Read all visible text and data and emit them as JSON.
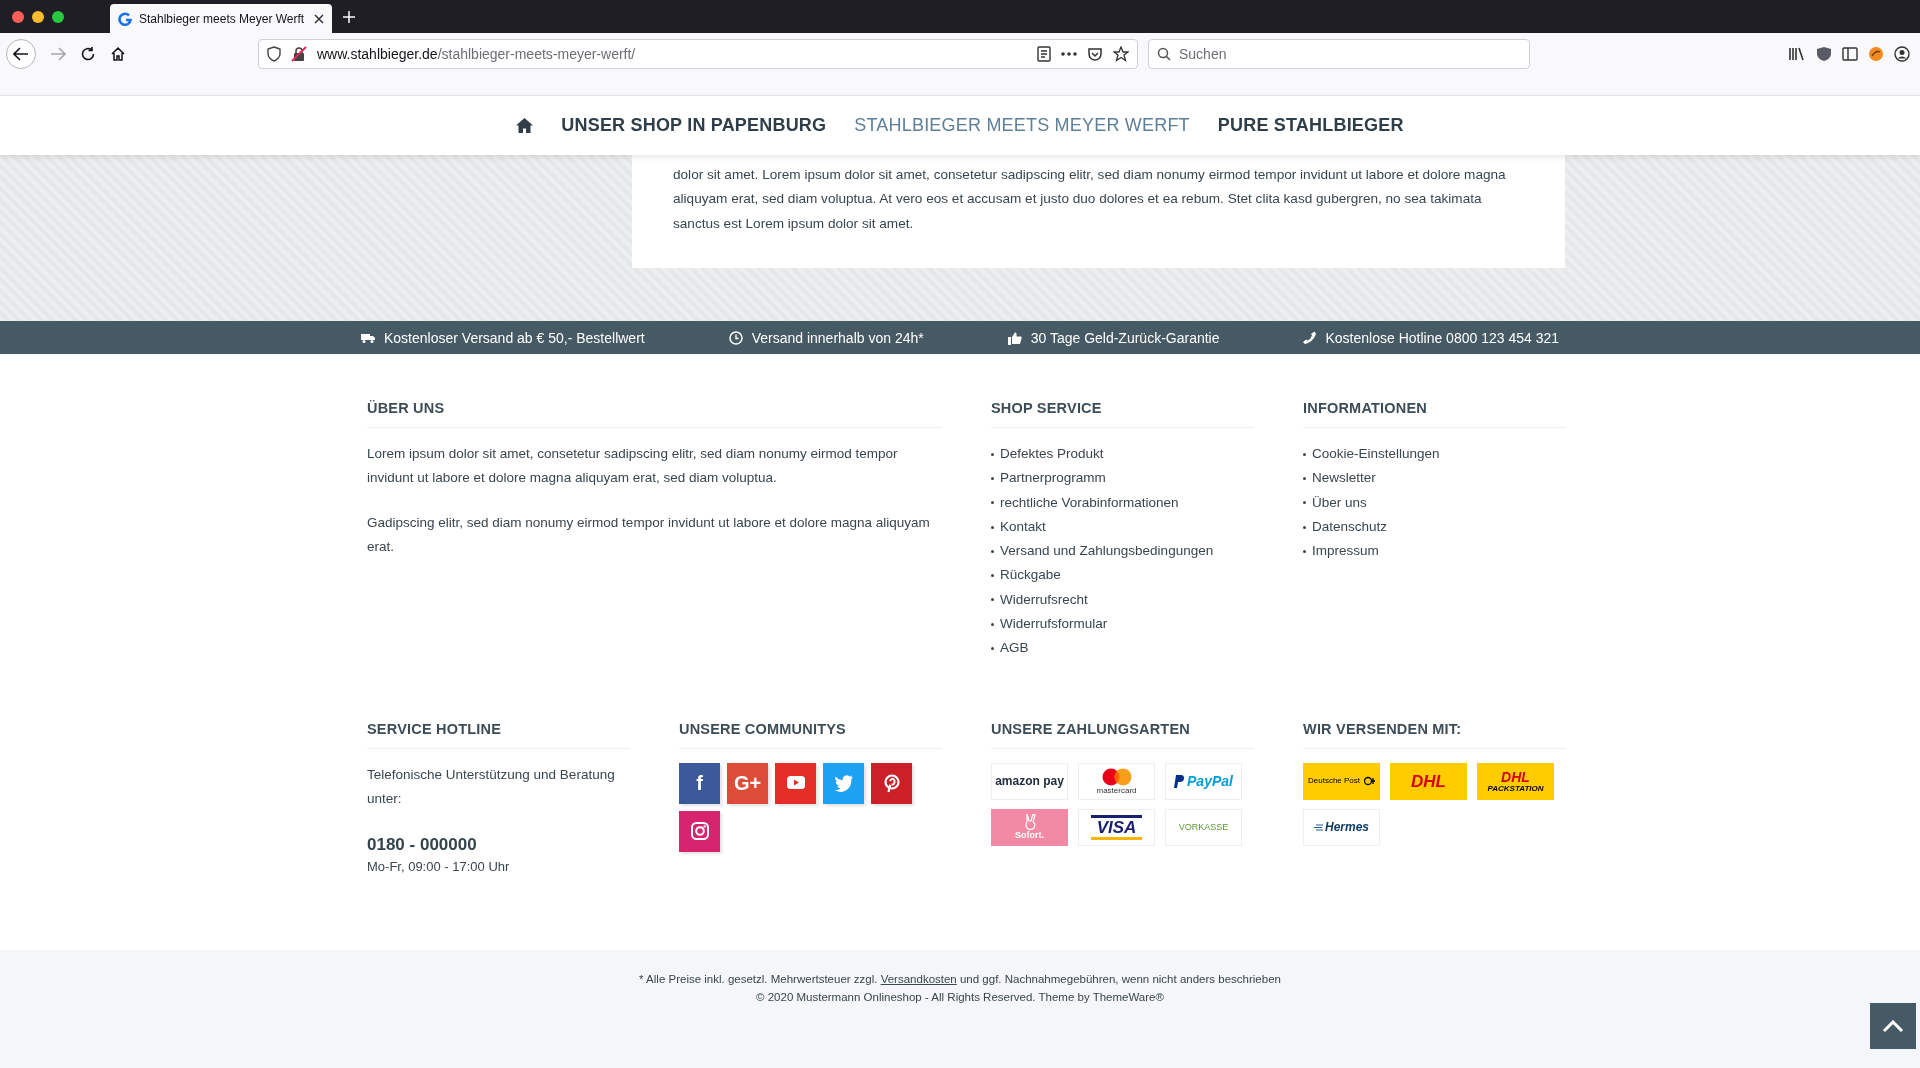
{
  "browser": {
    "tab": {
      "title": "Stahlbieger meets Meyer Werft",
      "selected": true
    },
    "url": {
      "host": "www.stahlbieger.de",
      "path": "/stahlbieger-meets-meyer-werft/"
    },
    "search": {
      "placeholder": "Suchen"
    }
  },
  "nav": {
    "items": [
      {
        "label": "UNSER SHOP IN PAPENBURG",
        "selected": false
      },
      {
        "label": "STAHLBIEGER MEETS MEYER WERFT",
        "selected": true
      },
      {
        "label": "PURE STAHLBIEGER",
        "selected": false
      }
    ]
  },
  "content": {
    "text": "dolor sit amet. Lorem ipsum dolor sit amet, consetetur sadipscing elitr, sed diam nonumy eirmod tempor invidunt ut labore et dolore magna aliquyam erat, sed diam voluptua. At vero eos et accusam et justo duo dolores et ea rebum. Stet clita kasd gubergren, no sea takimata sanctus est Lorem ipsum dolor sit amet."
  },
  "usp_bar": [
    {
      "text": "Kostenloser Versand ab € 50,- Bestellwert"
    },
    {
      "text": "Versand innerhalb von 24h*"
    },
    {
      "text": "30 Tage Geld-Zurück-Garantie"
    },
    {
      "text": "Kostenlose Hotline 0800 123 454 321"
    }
  ],
  "footer": {
    "about": {
      "title": "ÜBER UNS",
      "paragraphs": [
        "Lorem ipsum dolor sit amet, consetetur sadipscing elitr, sed diam nonumy eirmod tempor invidunt ut labore et dolore magna aliquyam erat, sed diam voluptua.",
        "Gadipscing elitr, sed diam nonumy eirmod tempor invidunt ut labore et dolore magna aliquyam erat."
      ]
    },
    "shop_service": {
      "title": "SHOP SERVICE",
      "links": [
        "Defektes Produkt",
        "Partnerprogramm",
        "rechtliche Vorabinformationen",
        "Kontakt",
        "Versand und Zahlungsbedingungen",
        "Rückgabe",
        "Widerrufsrecht",
        "Widerrufsformular",
        "AGB"
      ]
    },
    "information": {
      "title": "INFORMATIONEN",
      "links": [
        "Cookie-Einstellungen",
        "Newsletter",
        "Über uns",
        "Datenschutz",
        "Impressum"
      ]
    },
    "hotline": {
      "title": "SERVICE HOTLINE",
      "text": "Telefonische Unterstützung und Beratung unter:",
      "phone": "0180 - 000000",
      "hours": "Mo-Fr, 09:00 - 17:00 Uhr"
    },
    "communities": {
      "title": "UNSERE COMMUNITYS",
      "items": [
        {
          "kind": "facebook",
          "label": "f"
        },
        {
          "kind": "googleplus",
          "label": "G+"
        },
        {
          "kind": "youtube"
        },
        {
          "kind": "twitter"
        },
        {
          "kind": "pinterest"
        },
        {
          "kind": "instagram"
        }
      ]
    },
    "payments": {
      "title": "UNSERE ZAHLUNGSARTEN",
      "items": [
        {
          "kind": "amazonpay",
          "text": "amazon pay"
        },
        {
          "kind": "mastercard",
          "text": "mastercard"
        },
        {
          "kind": "paypal",
          "text": "PayPal"
        },
        {
          "kind": "sofort",
          "text": "Sofort."
        },
        {
          "kind": "visa",
          "text": "VISA"
        },
        {
          "kind": "vorkasse",
          "text": "VORKASSE"
        }
      ]
    },
    "shipping": {
      "title": "WIR VERSENDEN MIT:",
      "items": [
        {
          "kind": "deutschepost",
          "text": "Deutsche Post"
        },
        {
          "kind": "dhl",
          "text": "DHL"
        },
        {
          "kind": "packstation",
          "text": "DHL",
          "sub": "PACKSTATION"
        },
        {
          "kind": "hermes",
          "text": "Hermes"
        }
      ]
    }
  },
  "bottom": {
    "note_before": "* Alle Preise inkl. gesetzl. Mehrwertsteuer zzgl.",
    "note_link": "Versandkosten",
    "note_after": "und ggf. Nachnahmegebühren, wenn nicht anders beschrieben",
    "copyright": "© 2020 Mustermann Onlineshop - All Rights Reserved. Theme by ThemeWare®"
  }
}
